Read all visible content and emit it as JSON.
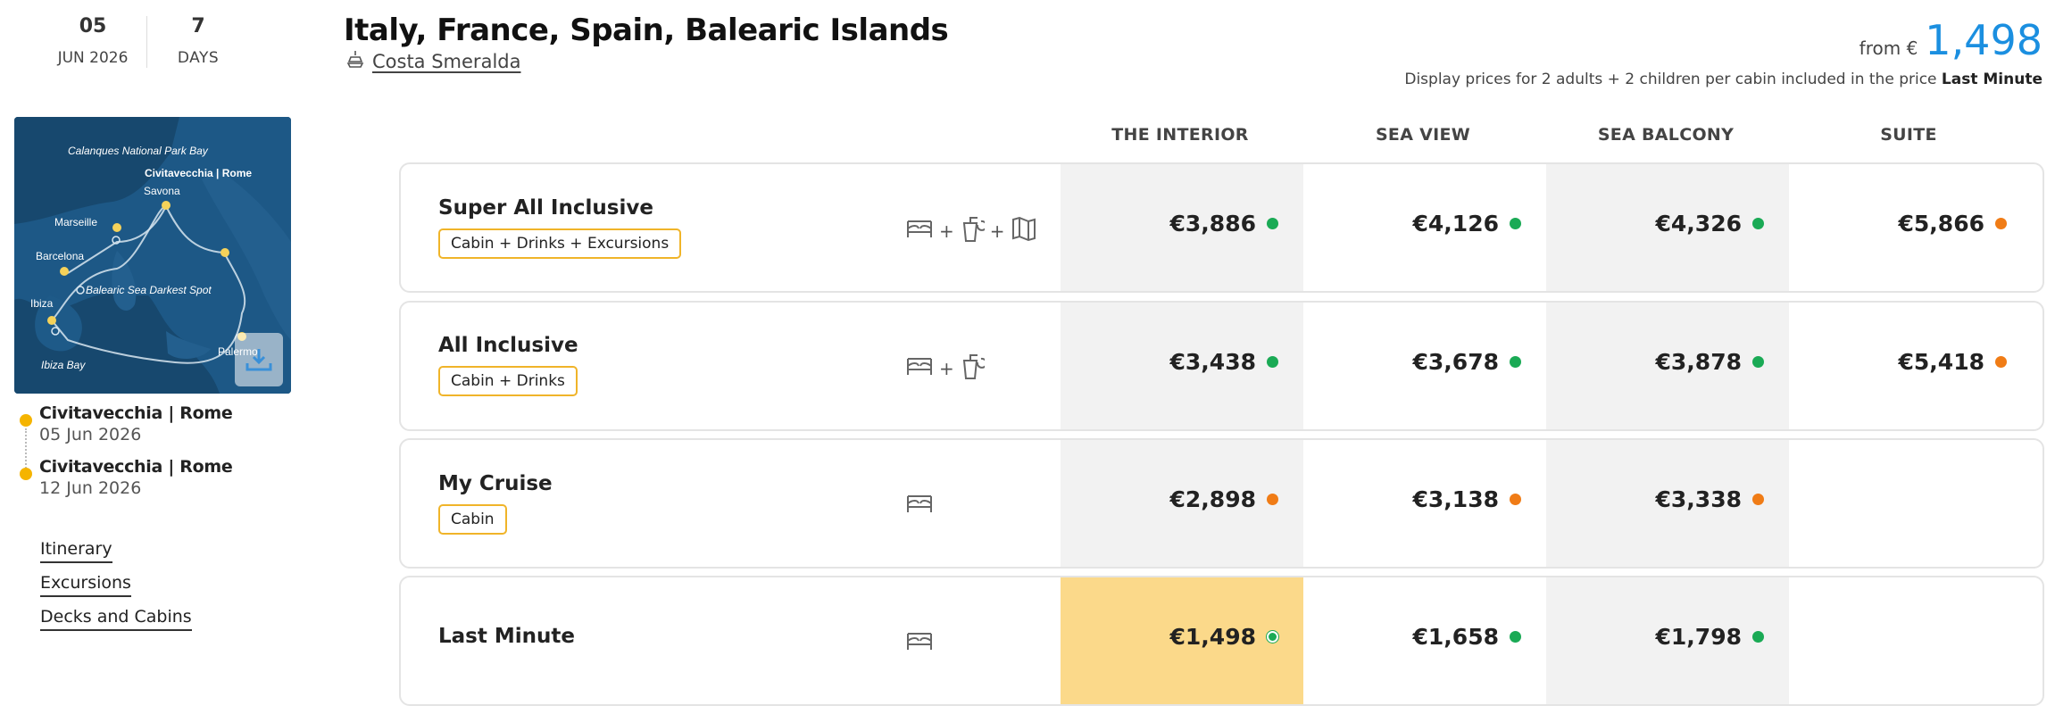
{
  "dates": {
    "day": "05",
    "month_year": "JUN 2026",
    "duration": "7",
    "duration_unit": "DAYS"
  },
  "map": {
    "labels": [
      "Calanques National Park Bay",
      "Civitavecchia | Rome",
      "Savona",
      "Marseille",
      "Barcelona",
      "Balearic Sea Darkest Spot",
      "Ibiza",
      "Palermo",
      "Ibiza Bay"
    ],
    "download_icon": "download-icon"
  },
  "route": [
    {
      "port": "Civitavecchia | Rome",
      "date": "05 Jun 2026"
    },
    {
      "port": "Civitavecchia | Rome",
      "date": "12 Jun 2026"
    }
  ],
  "side_links": [
    "Itinerary",
    "Excursions",
    "Decks and Cabins"
  ],
  "header": {
    "title": "Italy, France, Spain, Balearic Islands",
    "ship": "Costa Smeralda",
    "from_label": "from €",
    "from_price": "1,498",
    "note": "Display prices for 2 adults + 2 children per cabin included in the price",
    "note_bold": "Last Minute"
  },
  "columns": [
    "THE INTERIOR",
    "SEA VIEW",
    "SEA BALCONY",
    "SUITE"
  ],
  "packages": [
    {
      "name": "Super All Inclusive",
      "tag": "Cabin + Drinks + Excursions",
      "icons": [
        "bed-icon",
        "drink-icon",
        "map-icon"
      ],
      "prices": [
        "€3,886",
        "€4,126",
        "€4,326",
        "€5,866"
      ],
      "availability": [
        "green",
        "green",
        "green",
        "orange"
      ]
    },
    {
      "name": "All Inclusive",
      "tag": "Cabin + Drinks",
      "icons": [
        "bed-icon",
        "drink-icon"
      ],
      "prices": [
        "€3,438",
        "€3,678",
        "€3,878",
        "€5,418"
      ],
      "availability": [
        "green",
        "green",
        "green",
        "orange"
      ]
    },
    {
      "name": "My Cruise",
      "tag": "Cabin",
      "icons": [
        "bed-icon"
      ],
      "prices": [
        "€2,898",
        "€3,138",
        "€3,338",
        ""
      ],
      "availability": [
        "orange",
        "orange",
        "orange",
        ""
      ]
    },
    {
      "name": "Last Minute",
      "tag": "",
      "icons": [
        "bed-icon"
      ],
      "prices": [
        "€1,498",
        "€1,658",
        "€1,798",
        ""
      ],
      "availability": [
        "green",
        "green",
        "green",
        ""
      ]
    }
  ],
  "colors": {
    "accent": "#1b8fe0",
    "tag_border": "#f0b429",
    "highlight": "#fbd98a",
    "available": "#1aaa55",
    "limited": "#f07c16"
  }
}
